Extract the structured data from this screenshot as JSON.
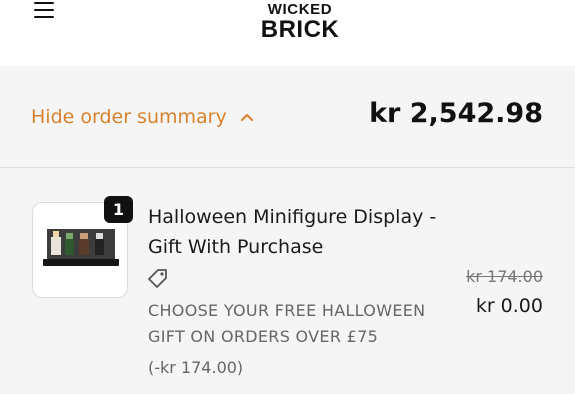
{
  "header": {
    "menu_icon": "hamburger-icon",
    "logo": {
      "line1": "WICKED",
      "line2": "BRICK"
    }
  },
  "summary": {
    "toggle_label": "Hide order summary",
    "toggle_icon": "chevron-up-icon",
    "total": "kr 2,542.98",
    "accent_color": "#d9822b"
  },
  "line_item": {
    "quantity": "1",
    "name": "Halloween Minifigure Display - Gift With Purchase",
    "tag_icon": "tag-icon",
    "discount_description": "CHOOSE YOUR FREE HALLOWEEN GIFT ON ORDERS OVER £75",
    "discount_amount": "(-kr 174.00)",
    "original_price": "kr 174.00",
    "final_price": "kr 0.00"
  }
}
